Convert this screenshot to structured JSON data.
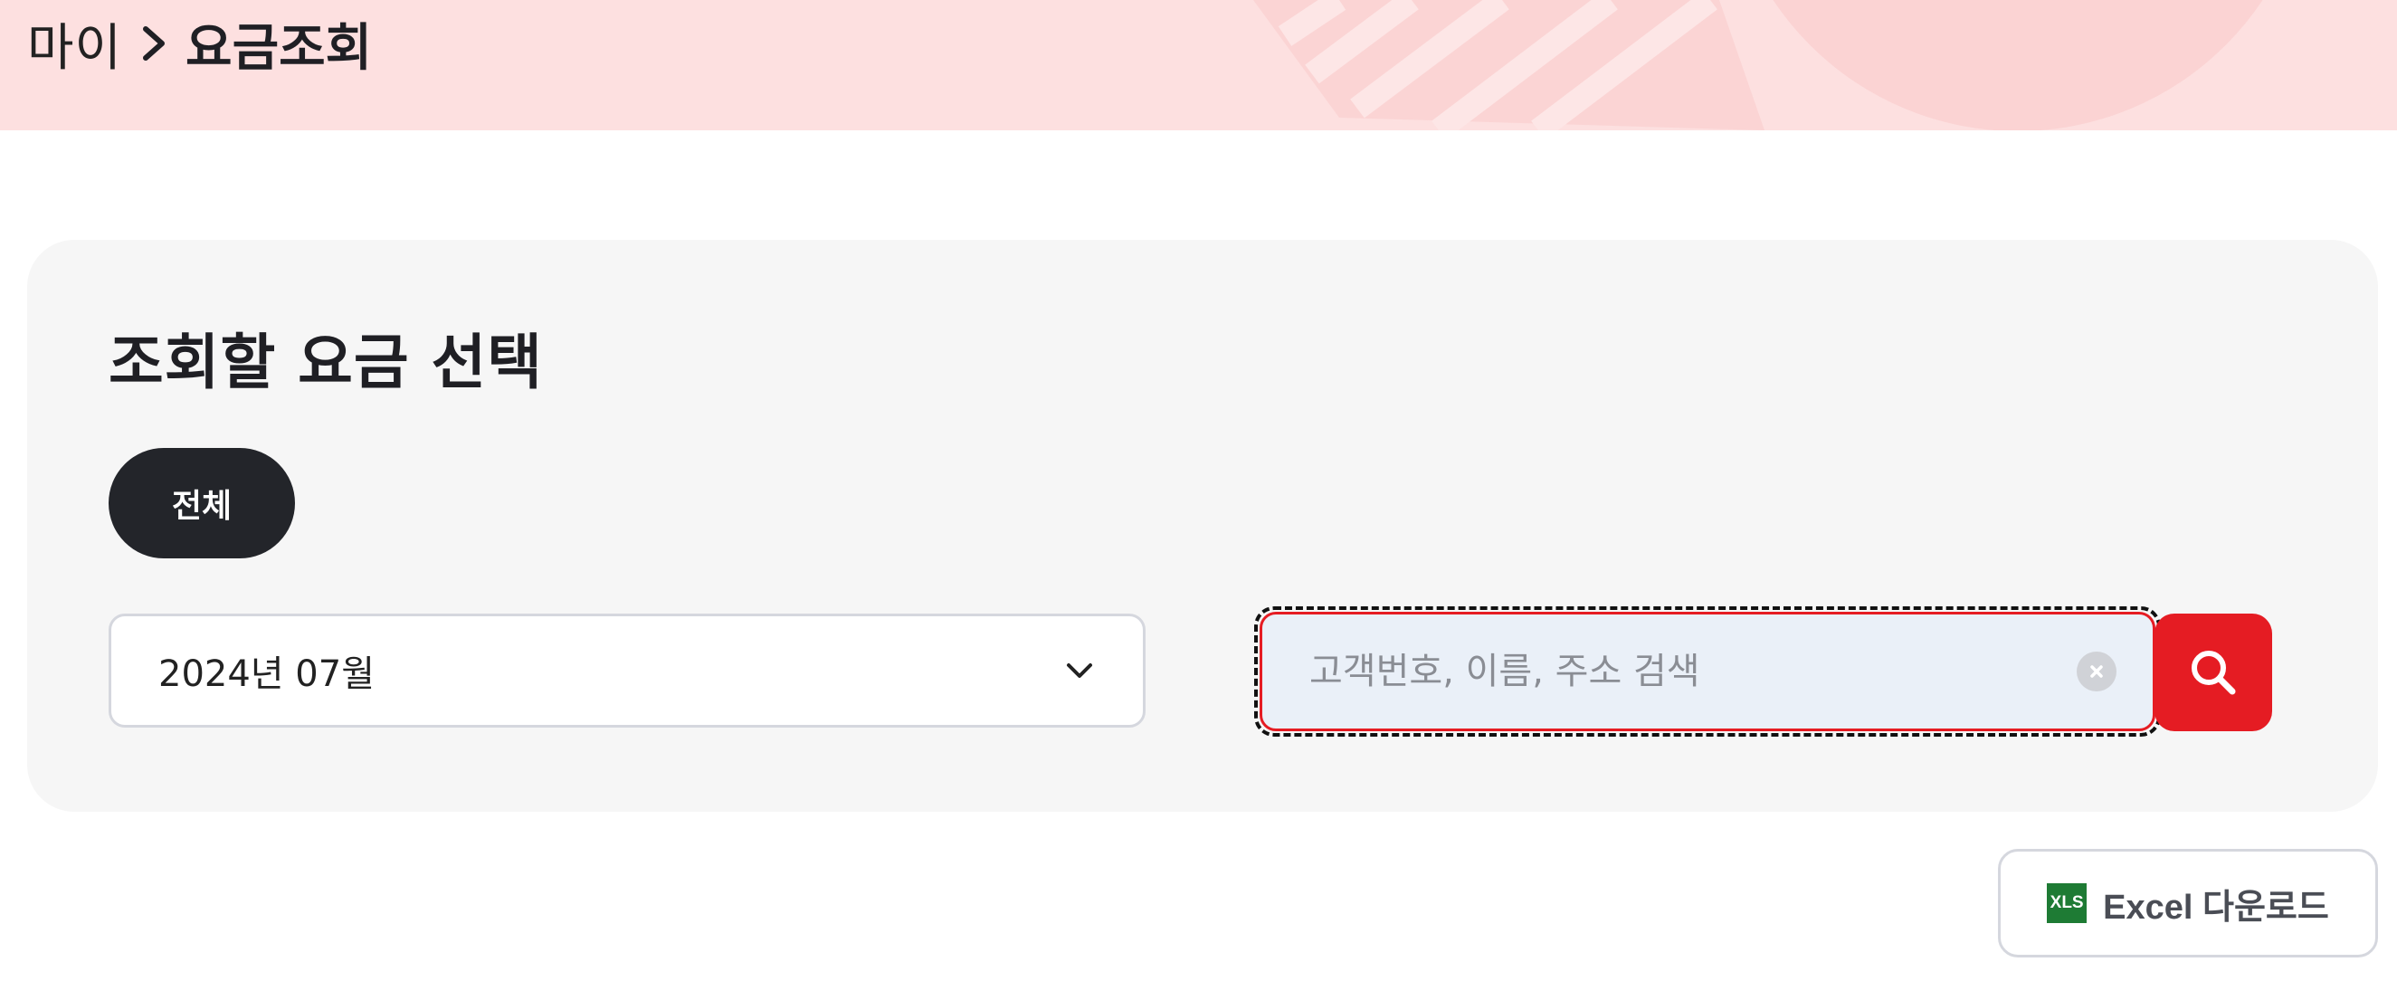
{
  "breadcrumb": {
    "home": "마이",
    "separator_icon": "chevron-right-icon",
    "current": "요금조회"
  },
  "panel": {
    "title": "조회할 요금 선택",
    "filter_chip": "전체",
    "month_select": {
      "value": "2024년 07월",
      "icon": "chevron-down-icon"
    },
    "search": {
      "value": "",
      "placeholder": "고객번호, 이름, 주소 검색",
      "clear_icon": "clear-icon",
      "button_icon": "search-icon"
    }
  },
  "excel": {
    "icon_text": "XLS",
    "label": "Excel 다운로드"
  },
  "colors": {
    "header_bg": "#fde0e0",
    "accent_red": "#e51c23",
    "chip_dark": "#23252a",
    "panel_bg": "#f6f6f6",
    "search_bg": "#eaf0f8",
    "xls_green": "#1e7b34"
  }
}
